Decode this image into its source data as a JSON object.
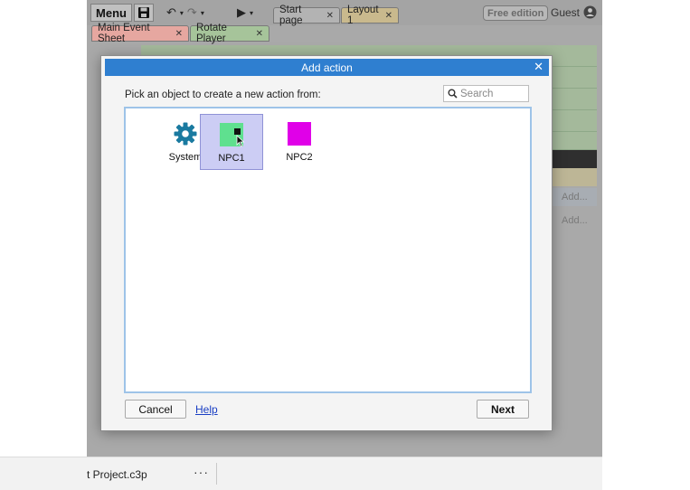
{
  "toolbar": {
    "menu_label": "Menu",
    "tabs": [
      "Start page",
      "Layout 1"
    ],
    "edition_badge": "Free edition",
    "user_label": "Guest"
  },
  "sheet_tabs": [
    "Main Event Sheet",
    "Rotate Player"
  ],
  "event_sheet": {
    "add_label_1": "Add...",
    "add_label_2": "Add..."
  },
  "dialog": {
    "title": "Add action",
    "prompt": "Pick an object to create a new action from:",
    "search_placeholder": "Search",
    "objects": [
      {
        "label": "System",
        "icon": "gear-icon",
        "color": "#1a7aa0"
      },
      {
        "label": "NPC1",
        "icon": "sprite-icon",
        "color": "#5fe08f",
        "selected": true
      },
      {
        "label": "NPC2",
        "icon": "sprite-icon",
        "color": "#e000e8"
      }
    ],
    "cancel_label": "Cancel",
    "help_label": "Help",
    "next_label": "Next"
  },
  "status_bar": {
    "file_name": "t Project.c3p",
    "more_label": "···"
  },
  "colors": {
    "accent": "#2f7fd0",
    "selection": "#cccdf4",
    "link": "#1a3fc4"
  }
}
